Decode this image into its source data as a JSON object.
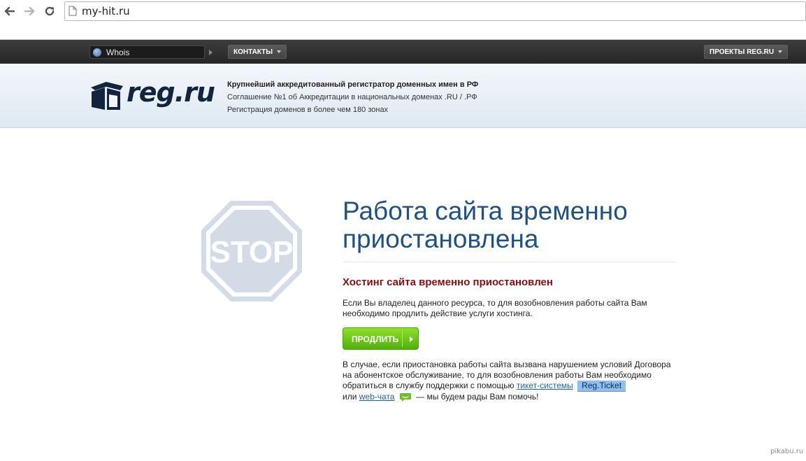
{
  "browser": {
    "url": "my-hit.ru"
  },
  "topbar": {
    "whois_label": "Whois",
    "contacts_label": "КОНТАКТЫ",
    "projects_label": "ПРОЕКТЫ REG.RU"
  },
  "header": {
    "logo_text": "reg.ru",
    "tagline_1": "Крупнейший аккредитованный регистратор доменных имен в РФ",
    "tagline_2": "Соглашение №1 об Аккредитации в национальных доменах .RU / .РФ",
    "tagline_3": "Регистрация доменов в более чем 180 зонах"
  },
  "stop_sign": {
    "text": "STOP"
  },
  "main": {
    "headline_1": "Работа сайта временно",
    "headline_2": "приостановлена",
    "subhead": "Хостинг сайта временно приостановлен",
    "para1_1": "Если Вы владелец данного ресурса, то для возобновления работы сайта Вам",
    "para1_2": "необходимо продлить действие услуги хостинга.",
    "renew_button": "ПРОДЛИТЬ",
    "para2_1": "В случае, если приостановка работы сайта вызвана нарушением условий Договора",
    "para2_2": "на абонентское обслуживание, то для возобновления работы Вам необходимо",
    "para2_3": "обратиться в службу поддержки с помощью",
    "ticket_link": "тикет-системы",
    "ticket_badge": "Reg.Ticket",
    "or_text": "или",
    "chat_link": "web-чата",
    "closing_text": "— мы будем рады Вам помочь!"
  },
  "watermark": "pikabu.ru",
  "colors": {
    "headline": "#1e5287",
    "subhead": "#8b0c0c",
    "button": "#5ab812",
    "link": "#1a62b8"
  }
}
